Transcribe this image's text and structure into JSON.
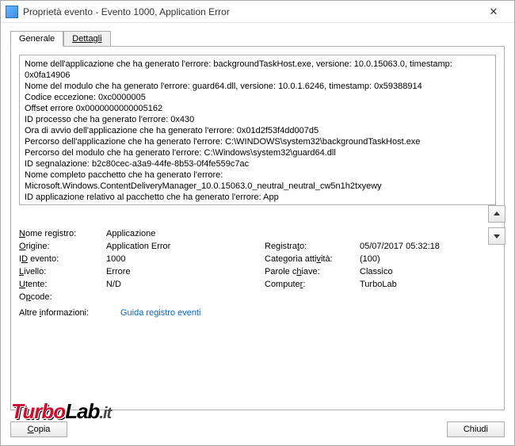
{
  "window": {
    "title": "Proprietà evento - Evento 1000, Application Error"
  },
  "tabs": {
    "general": "Generale",
    "details": "Dettagli"
  },
  "error_text": "Nome dell'applicazione che ha generato l'errore: backgroundTaskHost.exe, versione: 10.0.15063.0, timestamp: 0x0fa14906\nNome del modulo che ha generato l'errore: guard64.dll, versione: 10.0.1.6246, timestamp: 0x59388914\nCodice eccezione: 0xc0000005\nOffset errore 0x0000000000005162\nID processo che ha generato l'errore: 0x430\nOra di avvio dell'applicazione che ha generato l'errore: 0x01d2f53f4dd007d5\nPercorso dell'applicazione che ha generato l'errore: C:\\WINDOWS\\system32\\backgroundTaskHost.exe\nPercorso del modulo che ha generato l'errore: C:\\Windows\\system32\\guard64.dll\nID segnalazione: b2c80cec-a3a9-44fe-8b53-0f4fe559c7ac\nNome completo pacchetto che ha generato l'errore: Microsoft.Windows.ContentDeliveryManager_10.0.15063.0_neutral_neutral_cw5n1h2txyewy\nID applicazione relativo al pacchetto che ha generato l'errore: App",
  "fields": {
    "log_name_label": "Nome registro:",
    "log_name_value": "Applicazione",
    "source_label": "Origine:",
    "source_value": "Application Error",
    "event_id_label": "ID evento:",
    "event_id_value": "1000",
    "level_label": "Livello:",
    "level_value": "Errore",
    "user_label": "Utente:",
    "user_value": "N/D",
    "opcode_label": "Opcode:",
    "opcode_value": "",
    "logged_label": "Registrato:",
    "logged_value": "05/07/2017 05:32:18",
    "category_label": "Categoria attività:",
    "category_value": "(100)",
    "keywords_label": "Parole chiave:",
    "keywords_value": "Classico",
    "computer_label": "Computer:",
    "computer_value": "TurboLab",
    "more_info_label": "Altre informazioni:",
    "more_info_link": "Guida registro eventi"
  },
  "buttons": {
    "copy": "Copia",
    "close": "Chiudi"
  },
  "logo": {
    "turbo": "Turbo",
    "lab": "Lab",
    "it": ".it"
  }
}
